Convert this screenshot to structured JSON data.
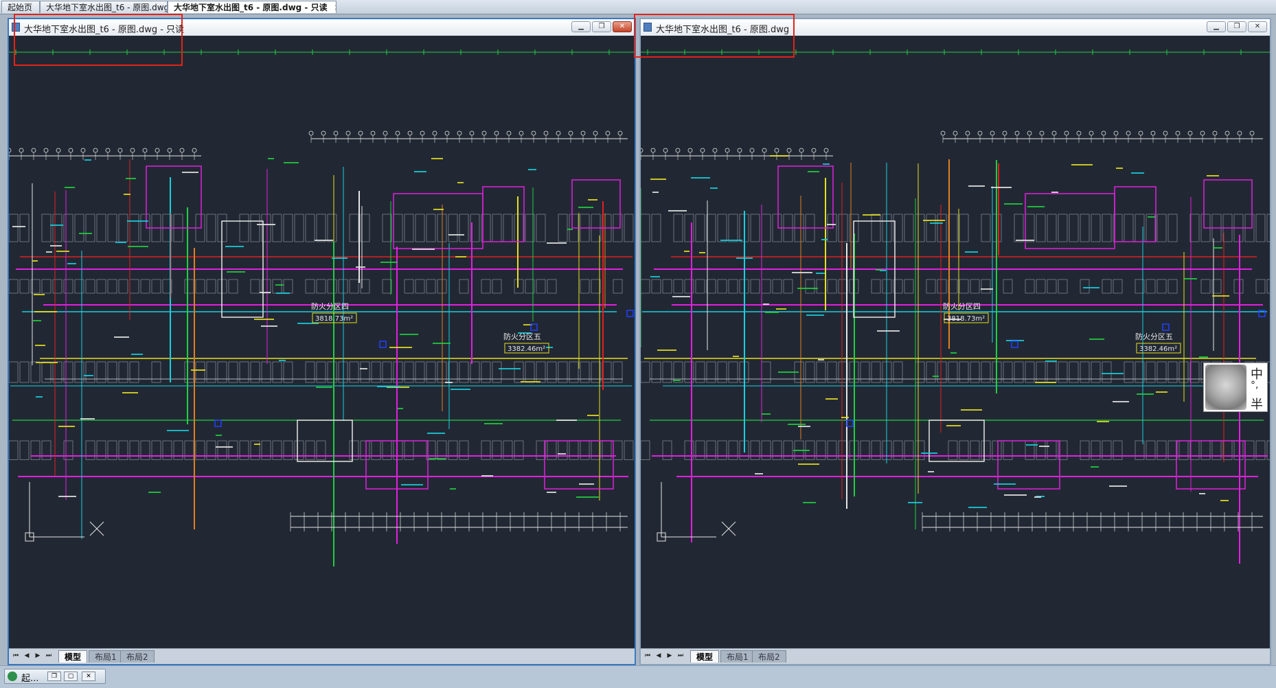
{
  "tabs": [
    {
      "label": "起始页"
    },
    {
      "label": "大华地下室水出图_t6 - 原图.dwg"
    },
    {
      "label": "大华地下室水出图_t6 - 原图.dwg - 只读",
      "close": "✕"
    }
  ],
  "windows": [
    {
      "title": "大华地下室水出图_t6 - 原图.dwg - 只读",
      "annotations": {
        "zone4": "防火分区四",
        "zone4_area": "3818.73m²",
        "zone5": "防火分区五",
        "zone5_area": "3382.46m²"
      },
      "layout_tabs": [
        "模型",
        "布局1",
        "布局2"
      ]
    },
    {
      "title": "大华地下室水出图_t6 - 原图.dwg",
      "annotations": {
        "zone4": "防火分区四",
        "zone4_area": "3818.73m²",
        "zone5": "防火分区五",
        "zone5_area": "3382.46m²"
      },
      "layout_tabs": [
        "模型",
        "布局1",
        "布局2"
      ]
    }
  ],
  "nav_icons": [
    "first-icon",
    "prev-icon",
    "next-icon",
    "last-icon"
  ],
  "window_buttons": [
    "minimize-icon",
    "restore-icon",
    "close-icon"
  ],
  "ime": {
    "c1": "中",
    "c2": "°,",
    "c3": "半"
  },
  "taskbar": {
    "label": "起..."
  },
  "colors": {
    "canvas": "#222833",
    "magenta": "#e020e0",
    "cyan": "#18d0e0",
    "yellow": "#e6e020",
    "green": "#20d040",
    "red": "#e02020",
    "orange": "#e08020",
    "white": "#e6e6e6",
    "highlight": "#e2231a"
  }
}
